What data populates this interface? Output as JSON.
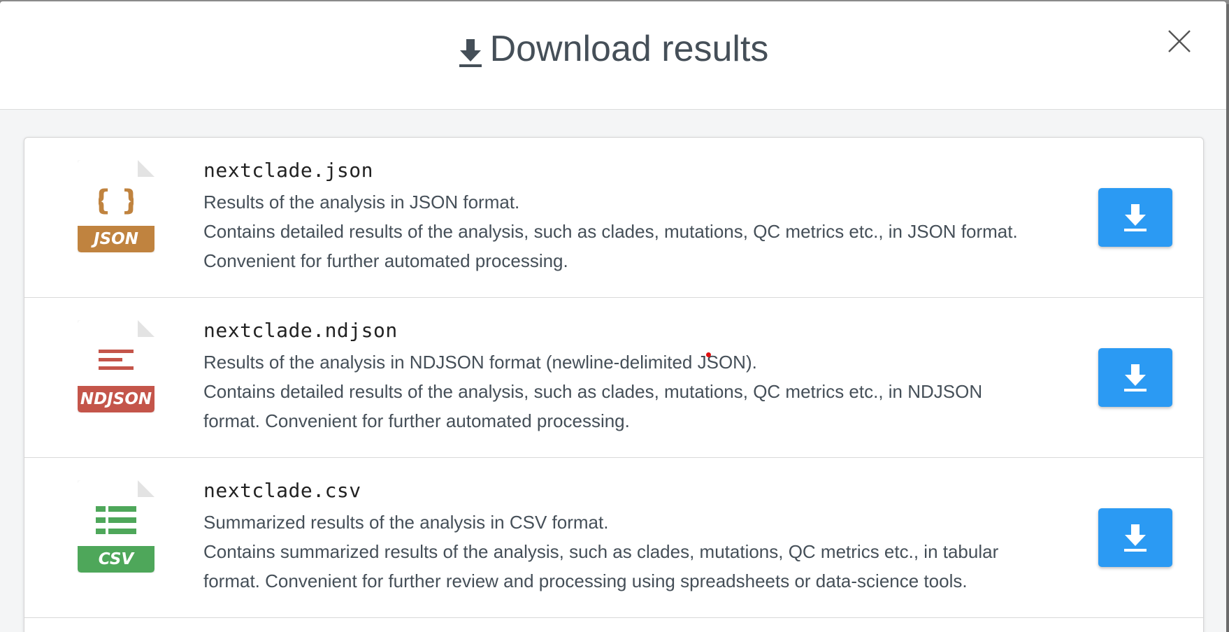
{
  "modal": {
    "title": "Download results",
    "title_icon": "download-icon",
    "close_icon": "close-icon"
  },
  "files": [
    {
      "filename": "nextclade.json",
      "icon_label": "JSON",
      "icon_color": "#c0833f",
      "lines": [
        "Results of the analysis in JSON format.",
        "Contains detailed results of the analysis, such as clades, mutations, QC metrics etc., in JSON format.",
        "Convenient for further automated processing."
      ]
    },
    {
      "filename": "nextclade.ndjson",
      "icon_label": "NDJSON",
      "icon_color": "#c4554a",
      "lines": [
        "Results of the analysis in NDJSON format (newline-delimited JSON).",
        "Contains detailed results of the analysis, such as clades, mutations, QC metrics etc., in NDJSON",
        "format. Convenient for further automated processing."
      ]
    },
    {
      "filename": "nextclade.csv",
      "icon_label": "CSV",
      "icon_color": "#4ea75a",
      "lines": [
        "Summarized results of the analysis in CSV format.",
        "Contains summarized results of the analysis, such as clades, mutations, QC metrics etc., in tabular",
        "format. Convenient for further review and processing using spreadsheets or data-science tools."
      ]
    }
  ],
  "colors": {
    "download_button": "#2b9af3",
    "title_text": "#454f58"
  }
}
